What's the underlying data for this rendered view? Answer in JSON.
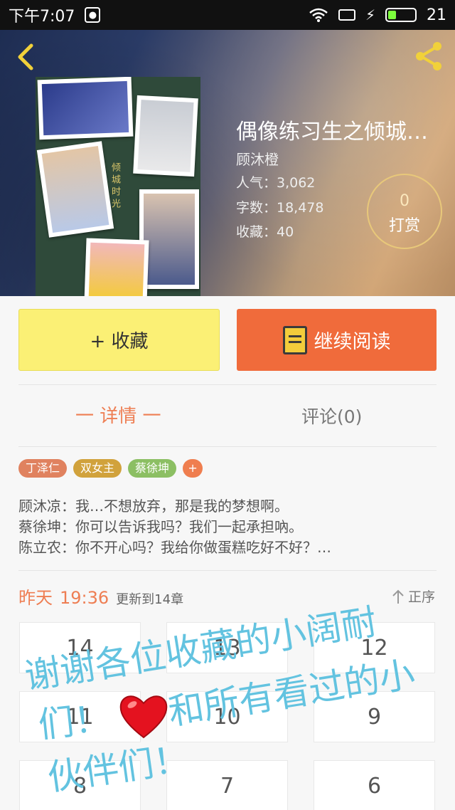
{
  "status_bar": {
    "time": "下午7:07",
    "battery": "21"
  },
  "book": {
    "title": "偶像练习生之倾城…",
    "author": "顾沐橙",
    "popularity": "人气：3,062",
    "word_count": "字数：18,478",
    "favorites": "收藏：40",
    "cover_caption": "倾城时光"
  },
  "reward": {
    "count": "0",
    "label": "打赏"
  },
  "actions": {
    "favorite": "+ 收藏",
    "continue_reading": "继续阅读"
  },
  "tabs": {
    "detail": "一 详情 一",
    "comments": "评论(0)"
  },
  "tags": [
    {
      "label": "丁泽仁",
      "color": "#e0825f"
    },
    {
      "label": "双女主",
      "color": "#d1a23c"
    },
    {
      "label": "蔡徐坤",
      "color": "#8cbf63"
    },
    {
      "label": "+",
      "color": "#ef7e4f"
    }
  ],
  "description": [
    "顾沐凉：我…不想放弃，那是我的梦想啊。",
    "蔡徐坤：你可以告诉我吗？我们一起承担吶。",
    "陈立农：你不开心吗？我给你做蛋糕吃好不好？…"
  ],
  "update": {
    "day": "昨天",
    "time": "19:36",
    "text": "更新到14章"
  },
  "sort_label": "正序",
  "chapters": [
    "14",
    "13",
    "12",
    "11",
    "10",
    "9",
    "8",
    "7",
    "6"
  ],
  "handwriting": {
    "line1": "谢谢各位收藏的小阔耐",
    "line2": "们！",
    "line3": "和所有看过的小",
    "line4": "伙伴们！",
    "color": "#63c3e0"
  },
  "colors": {
    "accent": "#f06b3b",
    "favorite_bg": "#fbf075",
    "reward_ring": "#e8c87a"
  }
}
